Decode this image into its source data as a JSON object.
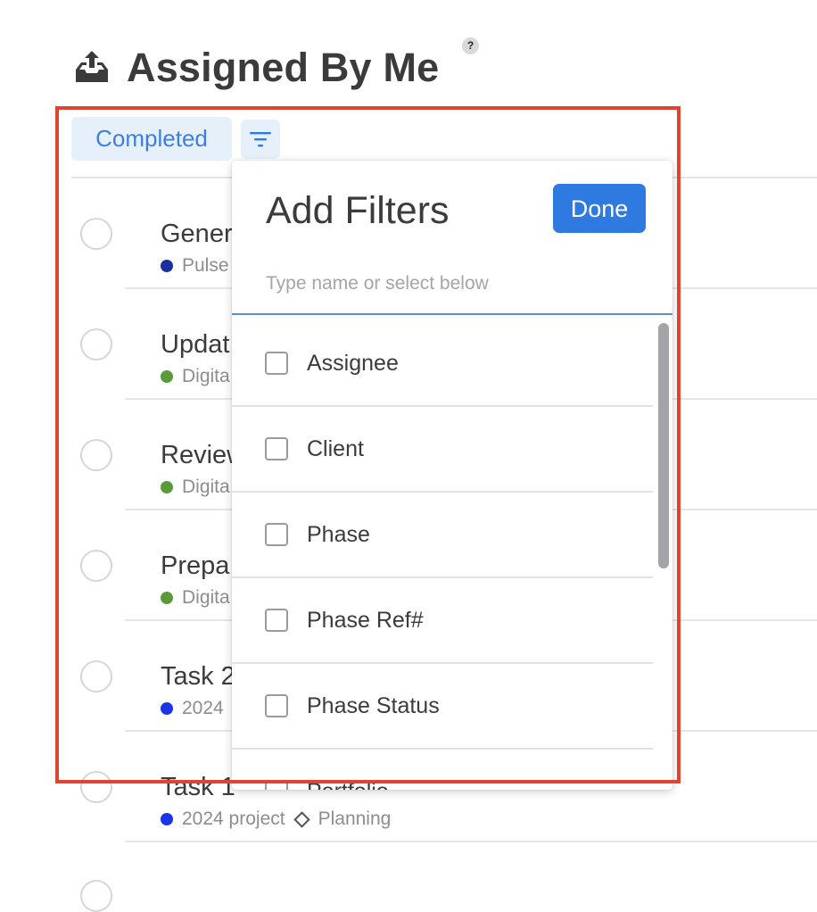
{
  "header": {
    "title": "Assigned By Me",
    "help_glyph": "?",
    "icon": "outbox-upload-icon"
  },
  "toolbar": {
    "status_chip": "Completed",
    "filter_icon": "filter-icon"
  },
  "tasks": [
    {
      "name": "Gener",
      "project": "Pulse",
      "project_color": "#1b2fa0",
      "phase": ""
    },
    {
      "name": "Updat",
      "project": "Digita",
      "project_color": "#5a9a3a",
      "phase": ""
    },
    {
      "name": "Review",
      "project": "Digita",
      "project_color": "#5a9a3a",
      "phase": ""
    },
    {
      "name": "Prepa",
      "project": "Digita",
      "project_color": "#5a9a3a",
      "phase": ""
    },
    {
      "name": "Task 2",
      "project": "2024",
      "project_color": "#1a34e8",
      "phase": ""
    },
    {
      "name": "Task 1",
      "project": "2024 project",
      "project_color": "#1a34e8",
      "phase": "Planning"
    }
  ],
  "filters_popover": {
    "title": "Add Filters",
    "done_label": "Done",
    "search_placeholder": "Type name or select below",
    "search_value": "",
    "options": [
      {
        "label": "Assignee",
        "checked": false
      },
      {
        "label": "Client",
        "checked": false
      },
      {
        "label": "Phase",
        "checked": false
      },
      {
        "label": "Phase Ref#",
        "checked": false
      },
      {
        "label": "Phase Status",
        "checked": false
      },
      {
        "label": "Portfolio",
        "checked": false
      }
    ]
  },
  "colors": {
    "accent": "#2f7ae0",
    "chip_bg": "#e6f0fb",
    "highlight": "#e0432f"
  }
}
